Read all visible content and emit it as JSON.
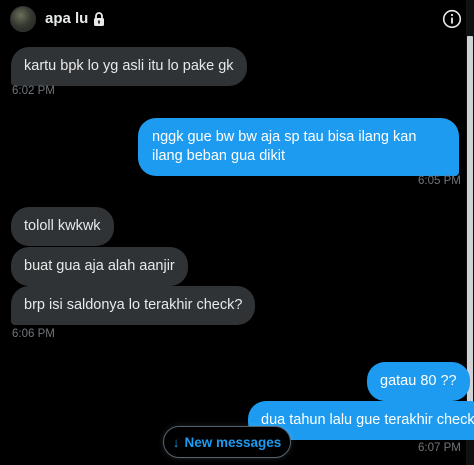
{
  "header": {
    "title": "apa lu",
    "icons": [
      "lock-icon",
      "info-icon"
    ]
  },
  "messages": [
    {
      "dir": "in",
      "text": "kartu bpk lo yg asli itu lo pake gk"
    },
    {
      "dir": "ts",
      "text": "6:02 PM"
    },
    {
      "dir": "out",
      "text": "nggk gue bw bw aja sp tau bisa ilang kan ilang beban gua dikit"
    },
    {
      "dir": "ts",
      "text": "6:05 PM"
    },
    {
      "dir": "in",
      "text": "tololl kwkwk"
    },
    {
      "dir": "in",
      "text": "buat gua aja alah aanjir"
    },
    {
      "dir": "in",
      "text": "brp isi saldonya lo terakhir check?"
    },
    {
      "dir": "ts",
      "text": "6:06 PM"
    },
    {
      "dir": "out",
      "text": "gatau 80 ??"
    },
    {
      "dir": "out",
      "text": "dua tahun lalu gue terakhir check"
    },
    {
      "dir": "ts",
      "text": "6:07 PM"
    }
  ],
  "new_messages_button": {
    "arrow": "↓",
    "label": "New messages"
  },
  "colors": {
    "background": "#000000",
    "incoming": "#2f3336",
    "outgoing": "#1d9bf0",
    "timestamp": "#71767b"
  }
}
